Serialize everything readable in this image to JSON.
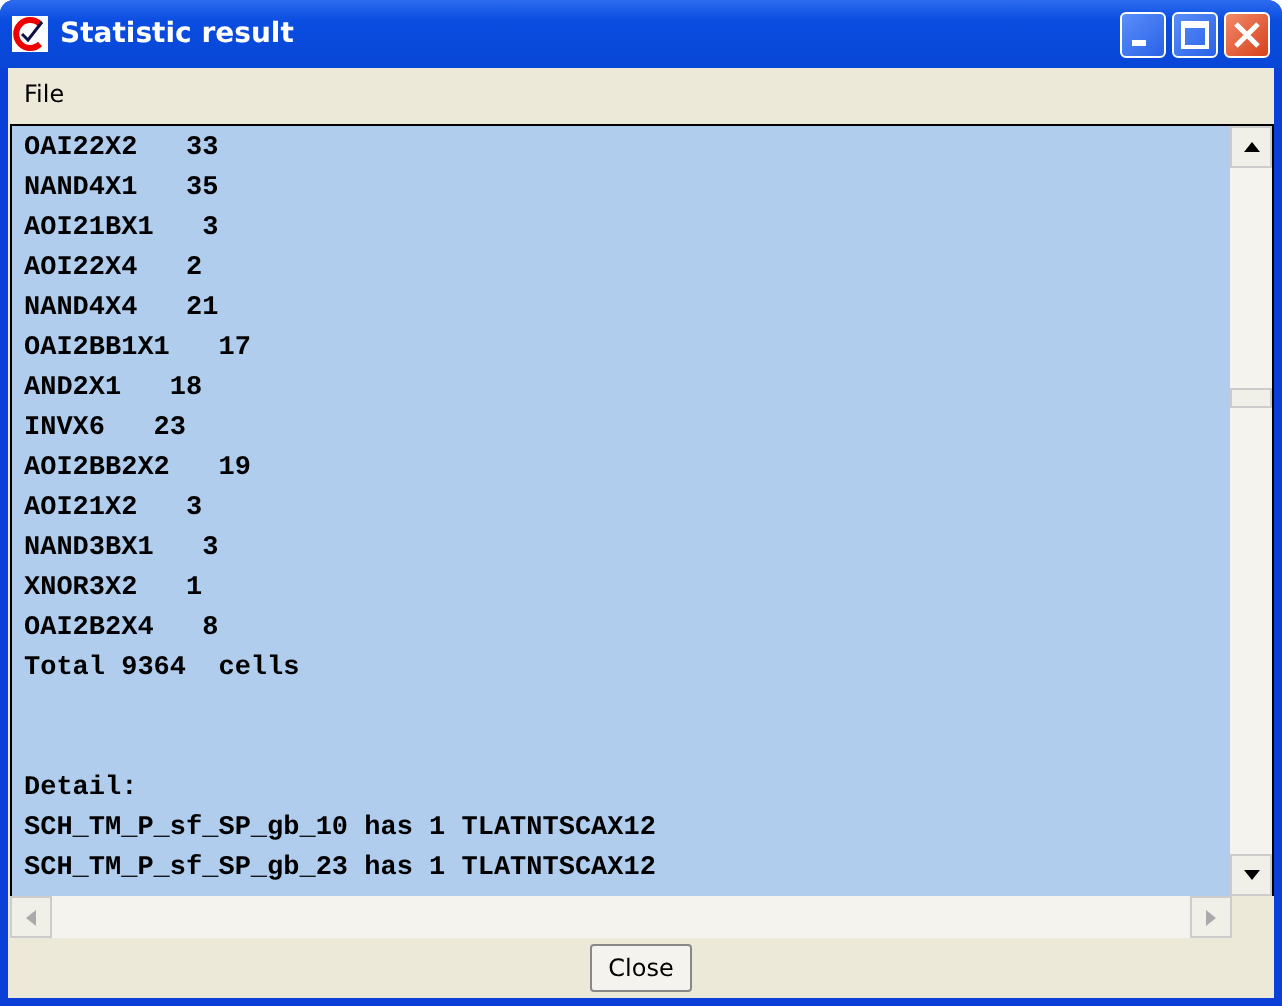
{
  "window": {
    "title": "Statistic result"
  },
  "menu": [
    "File"
  ],
  "summary_lines": [
    "OAI22X2   33",
    "NAND4X1   35",
    "AOI21BX1   3",
    "AOI22X4   2",
    "NAND4X4   21",
    "OAI2BB1X1   17",
    "AND2X1   18",
    "INVX6   23",
    "AOI2BB2X2   19",
    "AOI21X2   3",
    "NAND3BX1   3",
    "XNOR3X2   1",
    "OAI2B2X4   8",
    "Total 9364  cells"
  ],
  "detail_lines": [
    "Detail:",
    "SCH_TM_P_sf_SP_gb_10 has 1 TLATNTSCAX12",
    "SCH_TM_P_sf_SP_gb_23 has 1 TLATNTSCAX12"
  ],
  "buttons": [
    "Close"
  ]
}
